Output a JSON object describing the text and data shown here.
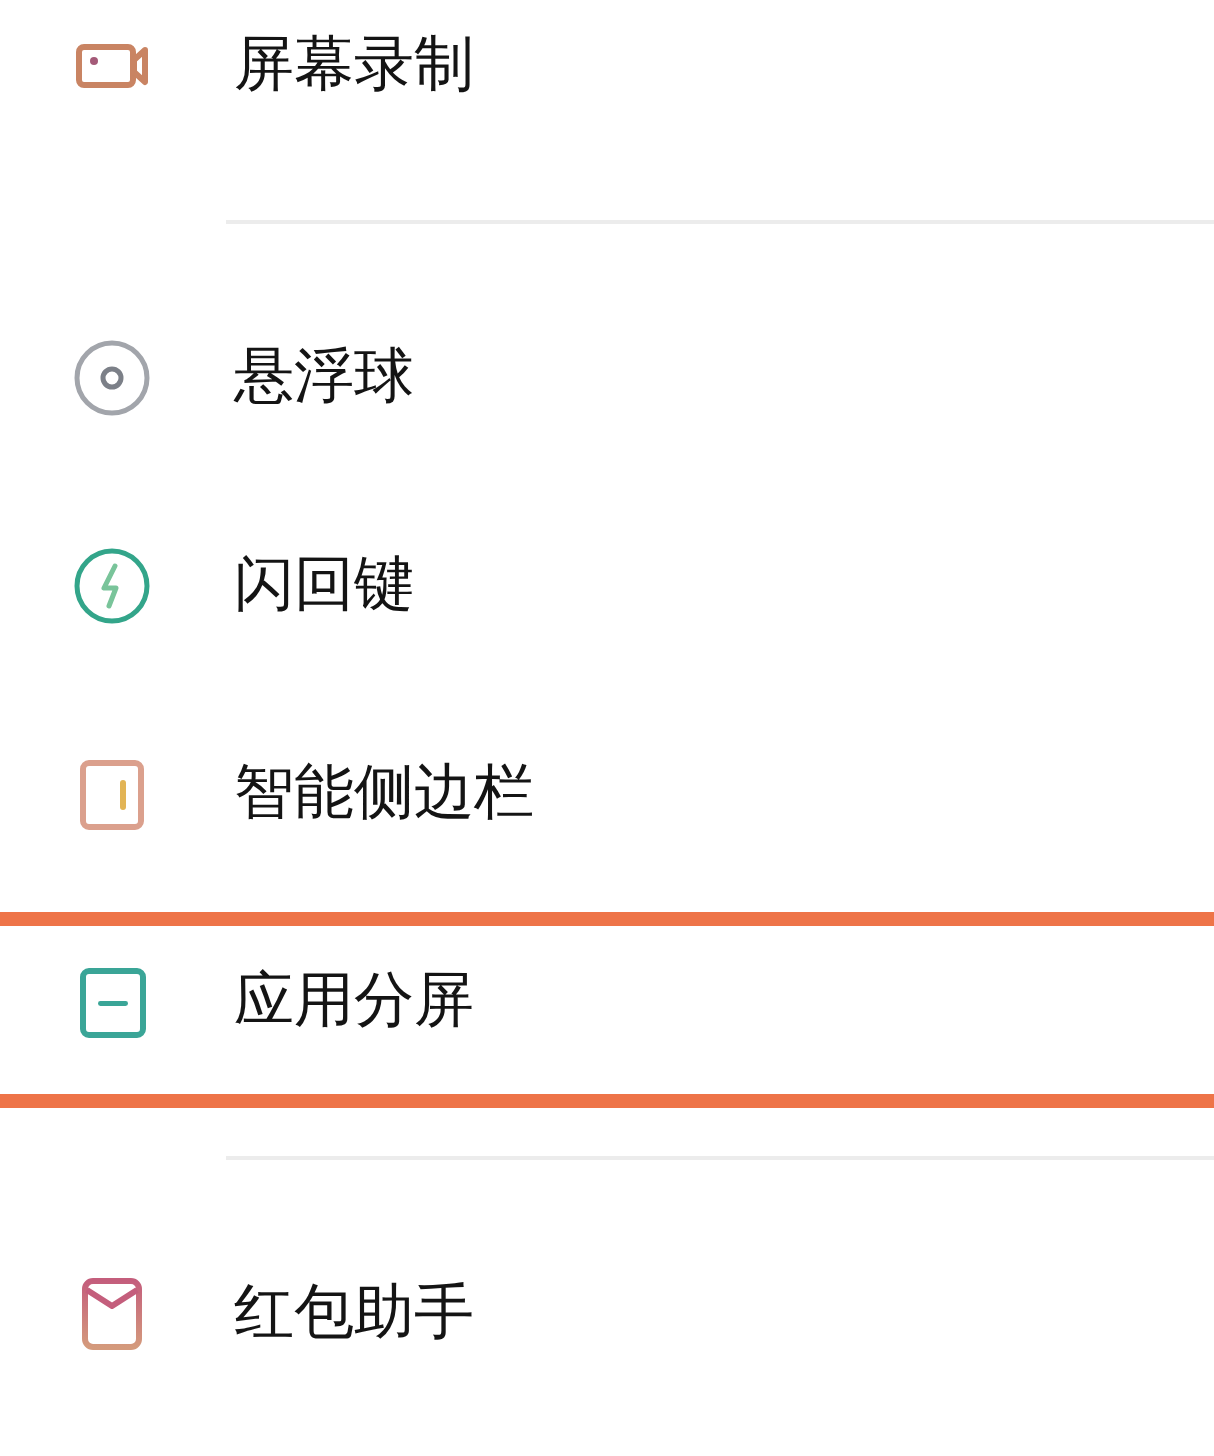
{
  "groups": [
    {
      "items": [
        {
          "kind": "screen-record",
          "label": "屏幕录制",
          "highlighted": false
        }
      ]
    },
    {
      "items": [
        {
          "kind": "floating-ball",
          "label": "悬浮球",
          "highlighted": false
        },
        {
          "kind": "flash-key",
          "label": "闪回键",
          "highlighted": false
        },
        {
          "kind": "sidebar",
          "label": "智能侧边栏",
          "highlighted": false
        },
        {
          "kind": "split-screen",
          "label": "应用分屏",
          "highlighted": true
        }
      ]
    },
    {
      "items": [
        {
          "kind": "red-packet",
          "label": "红包助手",
          "highlighted": false
        }
      ]
    }
  ]
}
